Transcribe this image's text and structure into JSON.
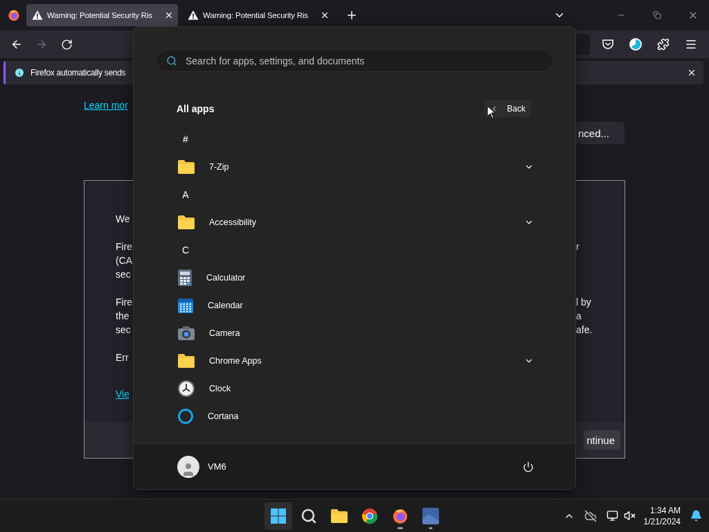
{
  "browser": {
    "tabs": [
      {
        "title": "Warning: Potential Security Ris",
        "selected": true
      },
      {
        "title": "Warning: Potential Security Ris",
        "selected": false
      }
    ],
    "nav": {
      "forward_disabled": true
    },
    "notification": {
      "text": "Firefox automatically sends"
    }
  },
  "page": {
    "learn_more": "Learn mor",
    "advanced_button": "nced...",
    "card_paragraphs": [
      {
        "lines": [
          {
            "left": "We"
          }
        ]
      },
      {
        "lines": [
          {
            "left": "Fire",
            "right": "r"
          },
          {
            "left": "(CA"
          },
          {
            "left": "sec"
          }
        ]
      },
      {
        "lines": [
          {
            "left": "Fire",
            "right": "l by"
          },
          {
            "left": "the",
            "right": "a"
          },
          {
            "left": "sec",
            "right": "afe."
          }
        ]
      },
      {
        "lines": [
          {
            "left": "Err"
          }
        ]
      }
    ],
    "view_link": "Vie",
    "continue_button": "ntinue"
  },
  "start_menu": {
    "search_placeholder": "Search for apps, settings, and documents",
    "heading": "All apps",
    "back_button": "Back",
    "items": [
      {
        "kind": "letter",
        "label": "#"
      },
      {
        "kind": "folder",
        "label": "7-Zip"
      },
      {
        "kind": "letter",
        "label": "A"
      },
      {
        "kind": "folder",
        "label": "Accessibility"
      },
      {
        "kind": "letter",
        "label": "C"
      },
      {
        "kind": "calculator",
        "label": "Calculator"
      },
      {
        "kind": "calendar",
        "label": "Calendar"
      },
      {
        "kind": "camera",
        "label": "Camera"
      },
      {
        "kind": "folder",
        "label": "Chrome Apps"
      },
      {
        "kind": "clock",
        "label": "Clock"
      },
      {
        "kind": "cortana",
        "label": "Cortana"
      }
    ],
    "user": "VM6"
  },
  "taskbar": {
    "apps": [
      {
        "kind": "start",
        "selected": true,
        "running": false
      },
      {
        "kind": "search",
        "selected": false,
        "running": false
      },
      {
        "kind": "explorer",
        "selected": false,
        "running": false
      },
      {
        "kind": "chrome",
        "selected": false,
        "running": false
      },
      {
        "kind": "firefox",
        "selected": false,
        "running": true
      },
      {
        "kind": "window",
        "selected": false,
        "running": true
      }
    ],
    "time": "1:34 AM",
    "date": "1/21/2024"
  }
}
